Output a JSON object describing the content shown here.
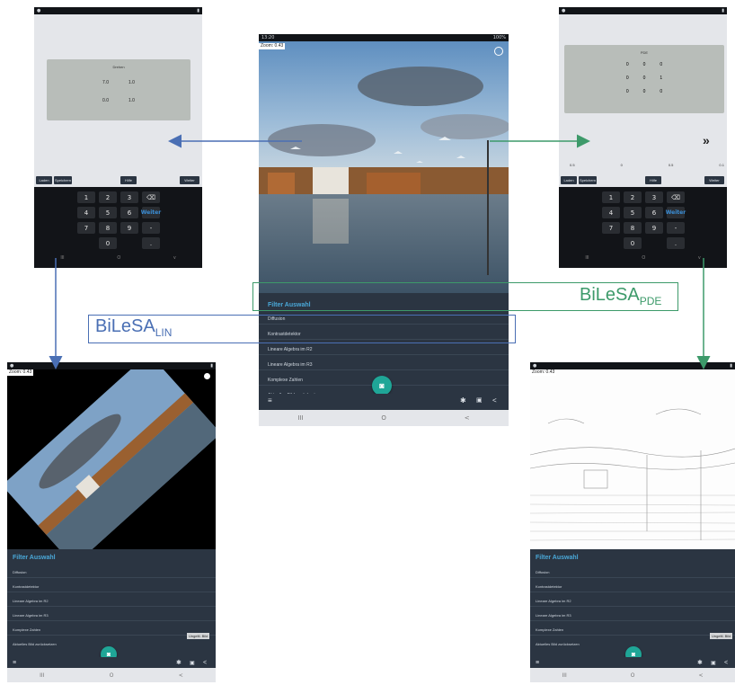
{
  "center": {
    "status_time": "13:20",
    "status_right": "100%",
    "zoom": "Zoom: 0.43",
    "menu_title": "Filter Auswahl",
    "menu_items": [
      "Diffusion",
      "Kontrastdetektor",
      "Lineare Algebra im R2",
      "Lineare Algebra im R3",
      "Komplexe Zahlen",
      "Aktuelles Bild zurücksetzen"
    ],
    "nav": [
      "III",
      "O",
      "<"
    ]
  },
  "left_top": {
    "dialog_title": "Drehen",
    "fields": [
      [
        "7.0",
        "1.0"
      ],
      [
        "0.0",
        "1.0"
      ]
    ],
    "buttons": [
      "Laden",
      "Speichern",
      "Hilfe",
      "Weiter"
    ],
    "keys": [
      "1",
      "2",
      "3",
      "⌫",
      "4",
      "5",
      "6",
      "Weiter",
      "7",
      "8",
      "9",
      "-",
      "",
      "0",
      "",
      "."
    ],
    "nav": [
      "III",
      "O",
      "v"
    ]
  },
  "right_top": {
    "dialog_title": "PDE",
    "matrix": [
      [
        "0",
        "0",
        "0"
      ],
      [
        "0",
        "0",
        "1"
      ],
      [
        "0",
        "0",
        "0"
      ]
    ],
    "next": "»",
    "params": [
      "0.5",
      "0",
      "0.5",
      "0.1"
    ],
    "buttons": [
      "Laden",
      "Speichern",
      "Hilfe",
      "Weiter"
    ],
    "keys": [
      "1",
      "2",
      "3",
      "⌫",
      "4",
      "5",
      "6",
      "Weiter",
      "7",
      "8",
      "9",
      "-",
      "",
      "0",
      "",
      "."
    ],
    "nav": [
      "III",
      "O",
      "v"
    ]
  },
  "left_bottom": {
    "zoom": "Zoom: 0.43",
    "menu_title": "Filter Auswahl",
    "menu_items": [
      "Diffusion",
      "Kontrastdetektor",
      "Lineare Algebra im R2",
      "Lineare Algebra im R3",
      "Komplexe Zahlen",
      "Aktuelles Bild zurücksetzen"
    ],
    "badge": "Ungeltl. Bild",
    "nav": [
      "III",
      "O",
      "<"
    ]
  },
  "right_bottom": {
    "zoom": "Zoom: 0.43",
    "menu_title": "Filter Auswahl",
    "menu_items": [
      "Diffusion",
      "Kontrastdetektor",
      "Lineare Algebra im R2",
      "Lineare Algebra im R3",
      "Komplexe Zahlen",
      "Aktuelles Bild zurücksetzen"
    ],
    "badge": "Ungeltl. Bild",
    "nav": [
      "III",
      "O",
      "<"
    ]
  },
  "labels": {
    "lin_main": "BiLeSA",
    "lin_sub": "LIN",
    "pde_main": "BiLeSA",
    "pde_sub": "PDE"
  },
  "colors": {
    "lin": "#4a6fb4",
    "pde": "#3d9a6a",
    "accent": "#1fa697",
    "menu_bg": "#2b3542"
  }
}
